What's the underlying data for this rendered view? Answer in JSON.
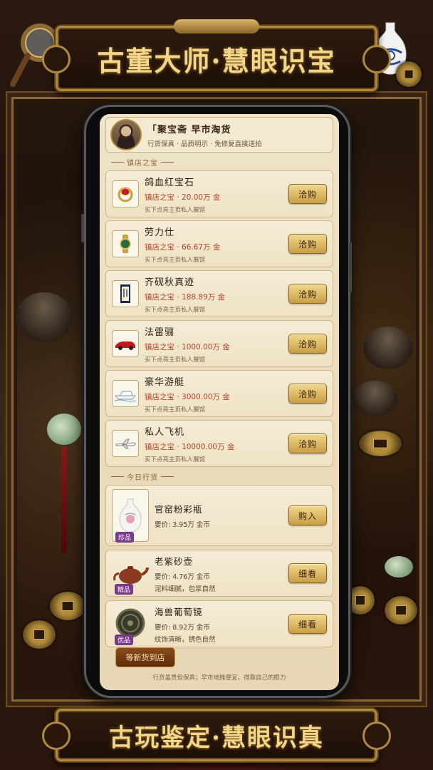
{
  "title_top": "古董大师·慧眼识宝",
  "title_bottom": "古玩鉴定·慧眼识真",
  "shop": {
    "name": "「聚宝斋 早市淘货",
    "tagline": "行货保真 · 品质明示 · 免修复直接送拍"
  },
  "sections": {
    "treasures_label": "镇店之宝",
    "today_label": "今日行货"
  },
  "treasures": [
    {
      "name": "鸽血红宝石",
      "price": "镇店之宝 · 20.00万 金",
      "note": "买下点亮主页私人展馆",
      "button": "洽购",
      "icon": "ruby-ring-icon"
    },
    {
      "name": "劳力仕",
      "price": "镇店之宝 · 66.67万 金",
      "note": "买下点亮主页私人展馆",
      "button": "洽购",
      "icon": "watch-icon"
    },
    {
      "name": "齐砚秋真迹",
      "price": "镇店之宝 · 188.89万 金",
      "note": "买下点亮主页私人展馆",
      "button": "洽购",
      "icon": "scroll-painting-icon"
    },
    {
      "name": "法雷骊",
      "price": "镇店之宝 · 1000.00万 金",
      "note": "买下点亮主页私人展馆",
      "button": "洽购",
      "icon": "sports-car-icon"
    },
    {
      "name": "豪华游艇",
      "price": "镇店之宝 · 3000.00万 金",
      "note": "买下点亮主页私人展馆",
      "button": "洽购",
      "icon": "yacht-icon"
    },
    {
      "name": "私人飞机",
      "price": "镇店之宝 · 10000.00万 金",
      "note": "买下点亮主页私人展馆",
      "button": "洽购",
      "icon": "private-jet-icon"
    }
  ],
  "goods": [
    {
      "name": "官窑粉彩瓶",
      "price": "要价: 3.95万 金币",
      "desc": "",
      "badge": "珍品",
      "button": "购入",
      "icon": "porcelain-vase-icon"
    },
    {
      "name": "老紫砂壶",
      "price": "要价: 4.76万 金币",
      "desc": "泥料细腻，包浆自然",
      "badge": "精品",
      "button": "细看",
      "icon": "teapot-icon"
    },
    {
      "name": "海兽葡萄镜",
      "price": "要价: 8.92万 金币",
      "desc": "纹饰清晰，锈色自然",
      "badge": "优品",
      "button": "细看",
      "icon": "bronze-mirror-icon"
    }
  ],
  "refresh_button": "等新货到店",
  "footer_note": "行货虽贵但保真；早市地摊便宜，得靠自己的眼力",
  "colors": {
    "accent_gold": "#c99e46",
    "price_red": "#b2432a",
    "badge_purple": "#7a3a8a",
    "paper": "#efe3c8"
  }
}
